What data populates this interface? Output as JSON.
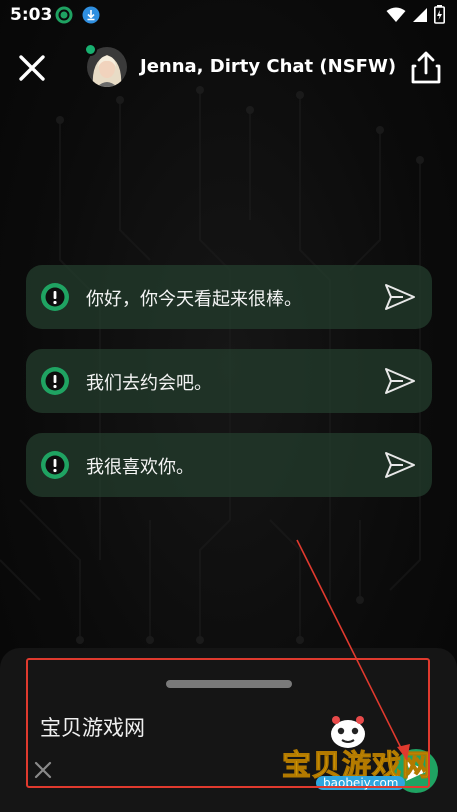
{
  "status_bar": {
    "time": "5:03",
    "left_icons": [
      "chatgpt-icon",
      "download-icon"
    ],
    "right_icons": [
      "wifi-icon",
      "signal-icon",
      "battery-charging-icon"
    ]
  },
  "header": {
    "title": "Jenna, Dirty Chat (NSFW)",
    "close_icon": "close-icon",
    "share_icon": "share-icon",
    "online": true
  },
  "suggestions": [
    {
      "text": "你好，你今天看起来很棒。"
    },
    {
      "text": "我们去约会吧。"
    },
    {
      "text": "我很喜欢你。"
    }
  ],
  "composer": {
    "text": "宝贝游戏网"
  },
  "watermark": {
    "text": "宝贝游戏网",
    "url": "baobeiy.com"
  },
  "colors": {
    "accent": "#1fa362",
    "suggestion_bg": "#243e2e",
    "annotation": "#e03a2e"
  }
}
